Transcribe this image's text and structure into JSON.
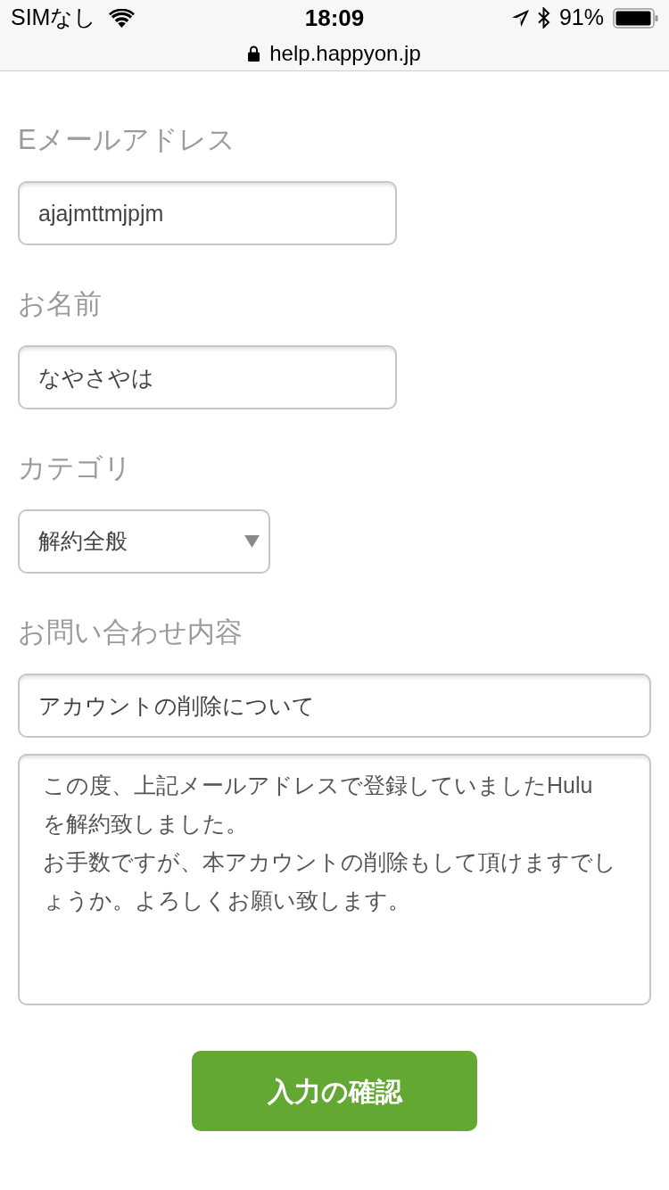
{
  "status_bar": {
    "carrier": "SIMなし",
    "time": "18:09",
    "battery": "91%"
  },
  "address_bar": {
    "url": "help.happyon.jp"
  },
  "form": {
    "fields": [
      {
        "kind": "text",
        "label": "Eメールアドレス",
        "value": "ajajmttmjpjm"
      },
      {
        "kind": "text",
        "label": "お名前",
        "value": "なやさやは"
      },
      {
        "kind": "select",
        "label": "カテゴリ",
        "value": "解約全般"
      },
      {
        "kind": "message",
        "label": "お問い合わせ内容",
        "subject": "アカウントの削除について",
        "lines": [
          "この度、上記メールアドレスで登録していましたHulu",
          "を解約致しました。",
          "お手数ですが、本アカウントの削除もして頂けますでし",
          "ょうか。よろしくお願い致します。"
        ]
      }
    ],
    "submit_button": "入力の確認"
  }
}
